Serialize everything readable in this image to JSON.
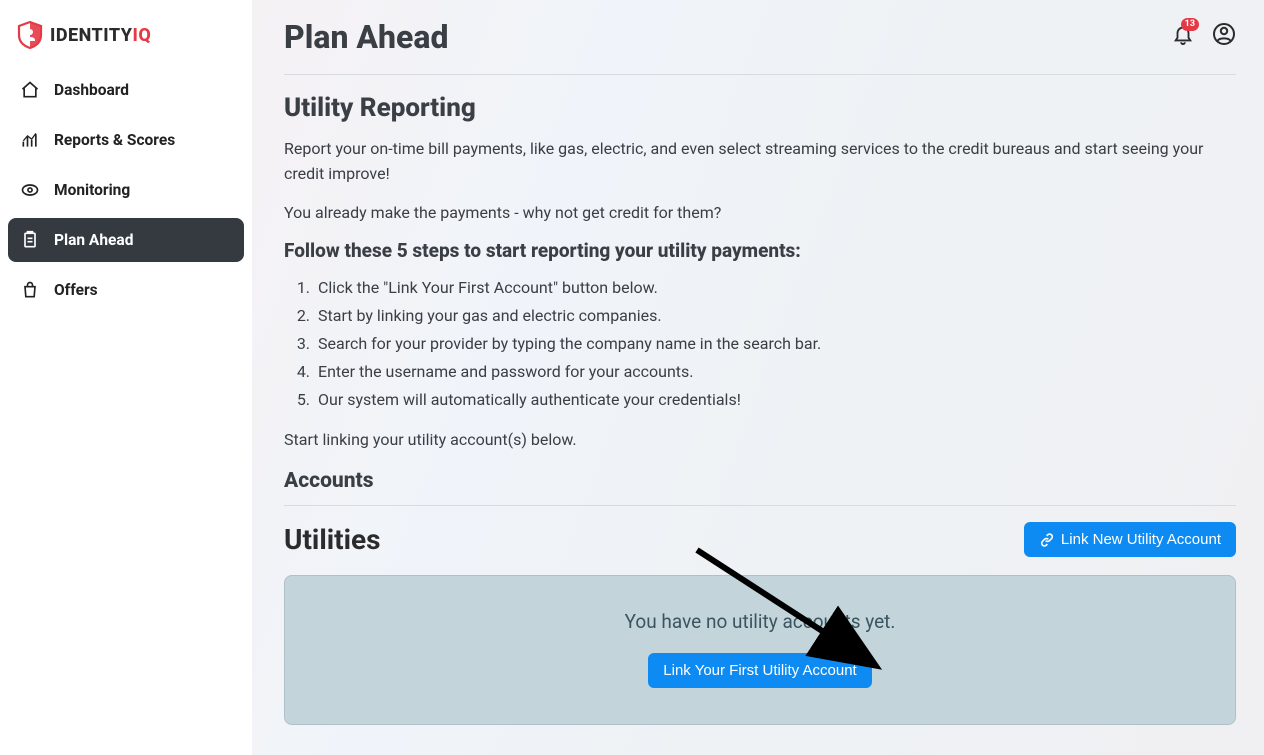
{
  "brand": {
    "name_part1": "IDENTITY",
    "name_part2": "IQ"
  },
  "sidebar": {
    "items": [
      {
        "label": "Dashboard"
      },
      {
        "label": "Reports & Scores"
      },
      {
        "label": "Monitoring"
      },
      {
        "label": "Plan Ahead"
      },
      {
        "label": "Offers"
      }
    ]
  },
  "header": {
    "title": "Plan Ahead",
    "notification_count": "13"
  },
  "main": {
    "section_title": "Utility Reporting",
    "intro_p1": "Report your on-time bill payments, like gas, electric, and even select streaming services to the credit bureaus and start seeing your credit improve!",
    "intro_p2": "You already make the payments - why not get credit for them?",
    "steps_header": "Follow these 5 steps to start reporting your utility payments:",
    "steps": [
      "Click the \"Link Your First Account\" button below.",
      "Start by linking your gas and electric companies.",
      "Search for your provider by typing the company name in the search bar.",
      "Enter the username and password for your accounts.",
      "Our system will automatically authenticate your credentials!"
    ],
    "start_linking": "Start linking your utility account(s) below.",
    "accounts_header": "Accounts",
    "utilities_header": "Utilities",
    "link_new_button": "Link New Utility Account",
    "empty_message": "You have no utility accounts yet.",
    "link_first_button": "Link Your First Utility Account"
  }
}
